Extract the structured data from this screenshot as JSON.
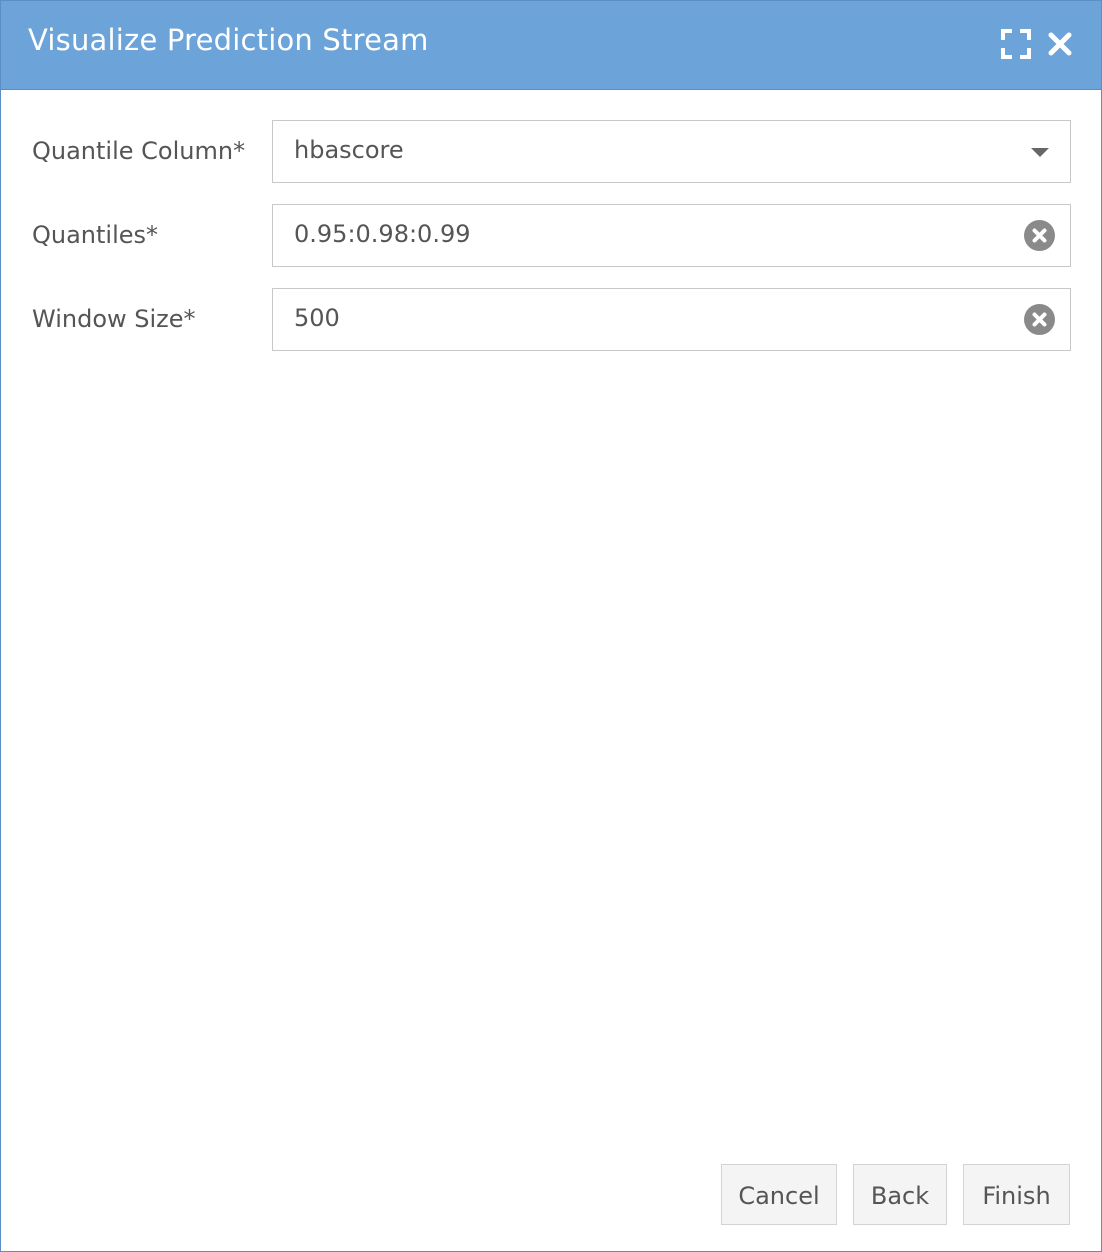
{
  "dialog": {
    "title": "Visualize Prediction Stream",
    "header_color": "#6ca3d8",
    "controls": {
      "maximize_icon": "expand-corners-icon",
      "close_icon": "close-x-icon"
    }
  },
  "form": {
    "quantile_column": {
      "label": "Quantile Column*",
      "value": "hbascore",
      "icon": "chevron-down-icon"
    },
    "quantiles": {
      "label": "Quantiles*",
      "value": "0.95:0.98:0.99",
      "icon": "clear-circle-icon"
    },
    "window_size": {
      "label": "Window Size*",
      "value": "500",
      "icon": "clear-circle-icon"
    }
  },
  "footer": {
    "cancel_label": "Cancel",
    "back_label": "Back",
    "finish_label": "Finish"
  }
}
